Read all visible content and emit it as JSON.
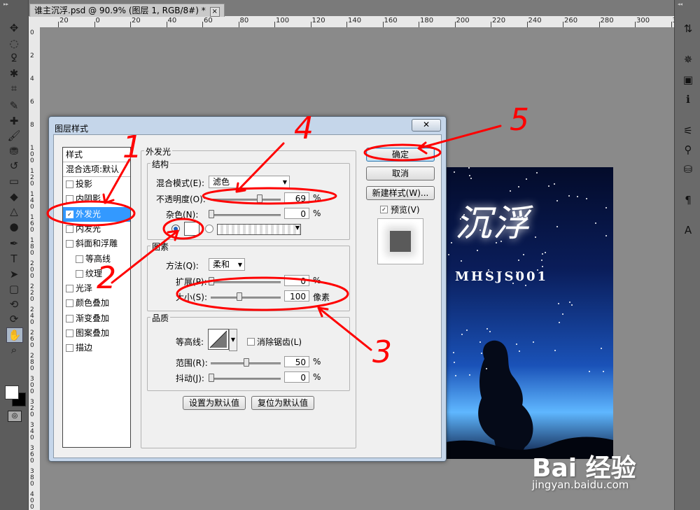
{
  "document_tab": {
    "title": "谁主沉浮.psd @ 90.9% (图层 1, RGB/8#) *",
    "close": "×"
  },
  "ruler": {
    "h_labels": [
      "20",
      "0",
      "20",
      "40",
      "60",
      "80",
      "100",
      "120",
      "140",
      "160",
      "180",
      "200",
      "220",
      "240",
      "260",
      "280",
      "300",
      "320"
    ],
    "v_labels": [
      "0",
      "2",
      "4",
      "6",
      "8",
      "1 0 0",
      "1 2 0",
      "1 4 0",
      "1 6 0",
      "1 8 0",
      "2 0 0",
      "2 2 0",
      "2 4 0",
      "2 6 0",
      "2 8 0",
      "3 0 0",
      "3 2 0",
      "3 4 0",
      "3 6 0",
      "3 8 0",
      "4 0 0"
    ]
  },
  "left_tools": [
    "move-icon",
    "marquee-icon",
    "lasso-icon",
    "magic-wand-icon",
    "crop-icon",
    "eyedropper-icon",
    "healing-icon",
    "brush-icon",
    "stamp-icon",
    "history-brush-icon",
    "eraser-icon",
    "paint-bucket-icon",
    "blur-icon",
    "dodge-icon",
    "pen-icon",
    "text-icon",
    "path-select-icon",
    "shape-icon",
    "3d-rotate-icon",
    "3d-orbit-icon",
    "hand-icon",
    "zoom-icon"
  ],
  "right_tools": [
    "swatch-icon",
    "navigator-icon",
    "image-icon",
    "info-icon",
    "adjust-icon",
    "brush-preset-icon",
    "clone-source-icon",
    "paragraph-icon",
    "character-icon"
  ],
  "poster": {
    "title": "沉浮",
    "subtitle": "MHSJS001"
  },
  "watermark": {
    "text": "Bai 经验",
    "url": "jingyan.baidu.com"
  },
  "dialog": {
    "title": "图层样式",
    "close": "✕",
    "style_list": {
      "header": "样式",
      "blend": "混合选项:默认",
      "items": [
        {
          "label": "投影",
          "checked": false
        },
        {
          "label": "内阴影",
          "checked": false
        },
        {
          "label": "外发光",
          "checked": true
        },
        {
          "label": "内发光",
          "checked": false
        },
        {
          "label": "斜面和浮雕",
          "checked": false
        },
        {
          "label": "等高线",
          "checked": false
        },
        {
          "label": "纹理",
          "checked": false
        },
        {
          "label": "光泽",
          "checked": false
        },
        {
          "label": "颜色叠加",
          "checked": false
        },
        {
          "label": "渐变叠加",
          "checked": false
        },
        {
          "label": "图案叠加",
          "checked": false
        },
        {
          "label": "描边",
          "checked": false
        }
      ]
    },
    "outer_glow": {
      "title": "外发光",
      "structure": {
        "title": "结构",
        "blend_mode_label": "混合模式(E):",
        "blend_mode": "滤色",
        "opacity_label": "不透明度(O):",
        "opacity": "69",
        "opacity_level": 69,
        "noise_label": "杂色(N):",
        "noise": "0",
        "noise_level": 0,
        "pct": "%"
      },
      "elements": {
        "title": "图素",
        "technique_label": "方法(Q):",
        "technique": "柔和",
        "spread_label": "扩展(P):",
        "spread": "0",
        "spread_level": 0,
        "size_label": "大小(S):",
        "size": "100",
        "size_level": 40,
        "px": "像素",
        "pct": "%"
      },
      "quality": {
        "title": "品质",
        "contour_label": "等高线:",
        "antialias_label": "消除锯齿(L)",
        "range_label": "范围(R):",
        "range": "50",
        "range_level": 50,
        "jitter_label": "抖动(J):",
        "jitter": "0",
        "jitter_level": 0,
        "pct": "%"
      },
      "make_default": "设置为默认值",
      "reset_default": "复位为默认值"
    },
    "buttons": {
      "ok": "确定",
      "cancel": "取消",
      "new_style": "新建样式(W)...",
      "preview": "预览(V)"
    }
  },
  "annotations": {
    "n1": "1",
    "n2": "2",
    "n3": "3",
    "n4": "4",
    "n5": "5",
    "color": "#ff0000"
  }
}
